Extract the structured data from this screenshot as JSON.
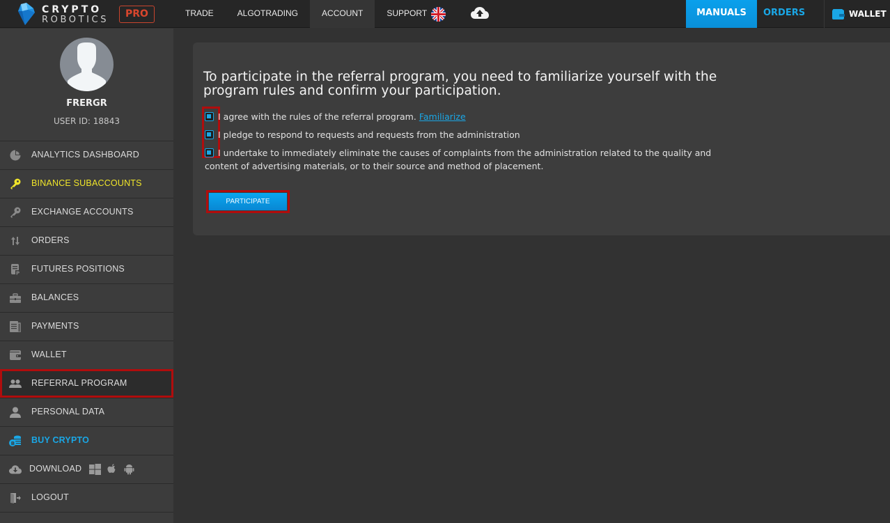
{
  "header": {
    "logo_top": "CRYPTO",
    "logo_bottom": "ROBOTICS",
    "pro_badge": "PRO",
    "nav": [
      {
        "label": "TRADE",
        "active": false
      },
      {
        "label": "ALGOTRADING",
        "active": false
      },
      {
        "label": "ACCOUNT",
        "active": true
      },
      {
        "label": "SUPPORT",
        "active": false
      }
    ],
    "language_icon": "uk-flag-icon",
    "upload_icon": "cloud-upload-icon",
    "manuals_label": "MANUALS",
    "orders_label": "ORDERS",
    "wallet_label": "WALLET",
    "colors": {
      "accent": "#0a9be6",
      "pro": "#d9462d"
    }
  },
  "sidebar": {
    "username": "FRERGR",
    "user_id": "USER ID: 18843",
    "items": [
      {
        "label": "ANALYTICS DASHBOARD",
        "icon": "pie-chart-icon"
      },
      {
        "label": "BINANCE SUBACCOUNTS",
        "icon": "key-icon",
        "color": "#f0e52a"
      },
      {
        "label": "EXCHANGE ACCOUNTS",
        "icon": "key-icon"
      },
      {
        "label": "ORDERS",
        "icon": "sort-arrows-icon"
      },
      {
        "label": "FUTURES POSITIONS",
        "icon": "document-p-icon"
      },
      {
        "label": "BALANCES",
        "icon": "briefcase-icon"
      },
      {
        "label": "PAYMENTS",
        "icon": "receipt-icon"
      },
      {
        "label": "WALLET",
        "icon": "wallet-icon"
      },
      {
        "label": "REFERRAL PROGRAM",
        "icon": "users-icon",
        "selected": true
      },
      {
        "label": "PERSONAL DATA",
        "icon": "user-icon"
      },
      {
        "label": "BUY CRYPTO",
        "icon": "coins-icon",
        "color": "#1aa7e6"
      },
      {
        "label": "DOWNLOAD",
        "icon": "cloud-download-icon",
        "platforms": [
          "windows-icon",
          "apple-icon",
          "android-icon"
        ]
      },
      {
        "label": "LOGOUT",
        "icon": "logout-door-icon"
      }
    ]
  },
  "main": {
    "title": "To participate in the referral program, you need to familiarize yourself with the program rules and confirm your participation.",
    "checkboxes": [
      {
        "label": "I agree with the rules of the referral program.",
        "link": "Familiarize",
        "checked": true
      },
      {
        "label": "I pledge to respond to requests and requests from the administration",
        "checked": true
      },
      {
        "label": "I undertake to immediately eliminate the causes of complaints from the administration related to the quality and",
        "label_cont": "content of advertising materials, or to their source and method of placement.",
        "checked": true
      }
    ],
    "participate_label": "PARTICIPATE"
  }
}
